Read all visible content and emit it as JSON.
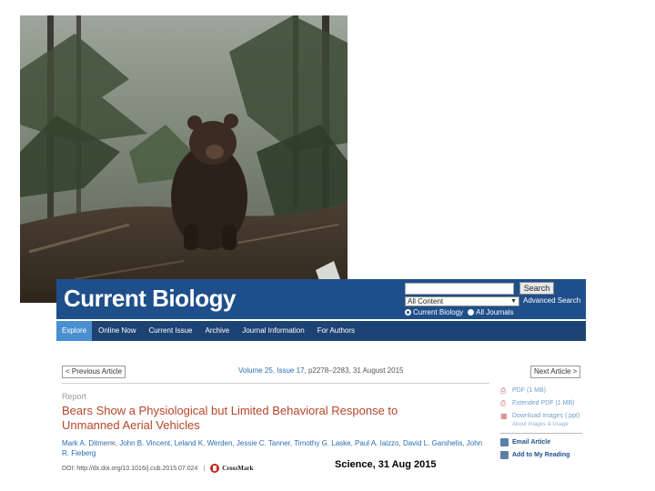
{
  "photo": {
    "icon": "bear-in-forest-photo"
  },
  "journal_page": {
    "logo": "Current Biology",
    "search": {
      "placeholder": "",
      "button": "Search"
    },
    "scope_select": {
      "selected": "All Content"
    },
    "advanced_search": "Advanced Search",
    "radios": [
      {
        "label": "Current Biology",
        "checked": true
      },
      {
        "label": "All Journals",
        "checked": false
      }
    ],
    "nav": [
      {
        "label": "Explore",
        "active": true
      },
      {
        "label": "Online Now",
        "active": false
      },
      {
        "label": "Current Issue",
        "active": false
      },
      {
        "label": "Archive",
        "active": false
      },
      {
        "label": "Journal Information",
        "active": false
      },
      {
        "label": "For Authors",
        "active": false
      }
    ],
    "prev_article": "< Previous Article",
    "next_article": "Next Article >",
    "citation": {
      "volume": "Volume 25, Issue 17,",
      "rest": "p2278–2283, 31 August 2015"
    },
    "article_type": "Report",
    "title": "Bears Show a Physiological but Limited Behavioral Response to Unmanned Aerial Vehicles",
    "authors_first": "Mark A. Ditmer",
    "authors_rest": ", John B. Vincent, Leland K. Werden, Jessie C. Tanner, Timothy G. Laske, Paul A. Iaizzo, David L. Garshelis, John R. Fieberg",
    "doi": "DOI: http://dx.doi.org/10.1016/j.cub.2015.07.024",
    "doi_sep": "|",
    "crossmark": "CrossMark",
    "sidebar": {
      "pdf": "PDF (1 MB)",
      "extended_pdf": "Extended PDF (1 MB)",
      "download_images": "Download Images (.ppt)",
      "about_images": "About Images & Usage",
      "email_article": "Email Article",
      "add_to_reading": "Add to My Reading"
    },
    "colors": {
      "header": "#1f4f8a",
      "nav": "#1d4374",
      "active_tab": "#4a8fd0",
      "title": "#b5452a",
      "link": "#2a6db5"
    }
  },
  "caption": "Science, 31 Aug 2015"
}
